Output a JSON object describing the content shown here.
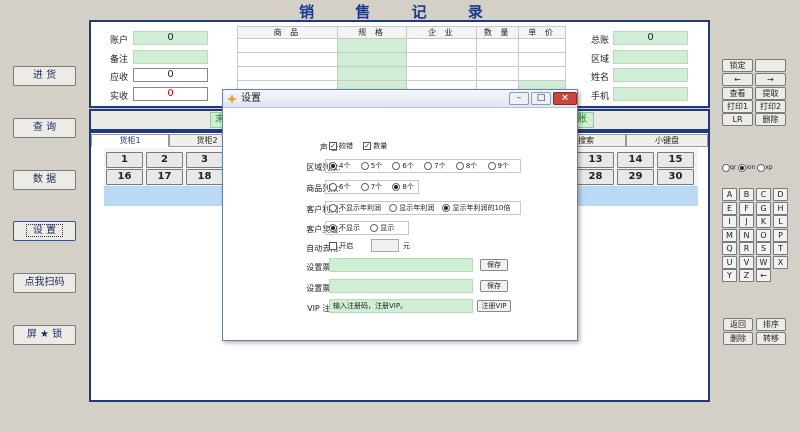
{
  "app": {
    "title": "销 售 记 录"
  },
  "left_buttons": [
    "进 货",
    "查 询",
    "数 据",
    "设 置",
    "点我扫码",
    "屏 ★ 锁"
  ],
  "sales_form": {
    "account_label": "账户",
    "account_value": "0",
    "note_label": "备注",
    "note_value": "",
    "receivable_label": "应收",
    "receivable_value": "0",
    "received_label": "实收",
    "received_value": "0"
  },
  "order_table": {
    "headers": [
      "商 品",
      "规 格",
      "企 业",
      "数 量",
      "单 价"
    ],
    "rows": 5
  },
  "summary": {
    "total_label": "总账",
    "total_value": "0",
    "region_label": "区域",
    "region_value": "",
    "name_label": "姓名",
    "name_value": "",
    "phone_label": "手机",
    "phone_value": ""
  },
  "partial_texts": {
    "left_green": "末",
    "right_green": "账"
  },
  "tabs": [
    "货柜1",
    "货柜2",
    "搜索",
    "小键盘"
  ],
  "number_row1": [
    "1",
    "2",
    "3",
    "13",
    "14",
    "15"
  ],
  "number_row2": [
    "16",
    "17",
    "18",
    "28",
    "29",
    "30"
  ],
  "right_top_buttons": [
    "锁定",
    "",
    "←",
    "→",
    "查看",
    "提取",
    "打印1",
    "打印2",
    "LR",
    "删除"
  ],
  "ime_options": [
    "qr",
    "ion",
    "xp"
  ],
  "keyboard": [
    "A",
    "B",
    "C",
    "D",
    "E",
    "F",
    "G",
    "H",
    "I",
    "J",
    "K",
    "L",
    "M",
    "N",
    "O",
    "P",
    "Q",
    "R",
    "S",
    "T",
    "U",
    "V",
    "W",
    "X",
    "Y",
    "Z",
    "←"
  ],
  "right_bottom_buttons": [
    "返回",
    "排序",
    "删除",
    "转移"
  ],
  "dialog": {
    "title": "设置",
    "voice_label": "声 音:",
    "voice_options": [
      {
        "label": "较错",
        "checked": true
      },
      {
        "label": "数量",
        "checked": true
      }
    ],
    "region_cols_label": "区域列数:",
    "region_cols_options": [
      "4个",
      "5个",
      "6个",
      "7个",
      "8个",
      "9个"
    ],
    "region_cols_selected": 0,
    "product_cols_label": "商品列数:",
    "product_cols_options": [
      "6个",
      "7个",
      "8个"
    ],
    "product_cols_selected": 2,
    "profit_label": "客户利润:",
    "profit_options": [
      "不显示年利润",
      "显示年利润",
      "显示年利润的10倍"
    ],
    "profit_selected": 2,
    "reward_label": "客户奖值:",
    "reward_options": [
      "不显示",
      "显示"
    ],
    "reward_selected": 0,
    "rounding_label": "自动去角:",
    "rounding_check_label": "开启",
    "rounding_checked": false,
    "rounding_value": "",
    "rounding_unit": "元",
    "header_label": "设置票首:",
    "header_value": "",
    "footer_label": "设置票尾:",
    "footer_value": "",
    "save_label": "保存",
    "vip_label": "VIP 注册:",
    "vip_placeholder": "输入注册码，注册VIP。",
    "vip_button": "注册VIP"
  }
}
